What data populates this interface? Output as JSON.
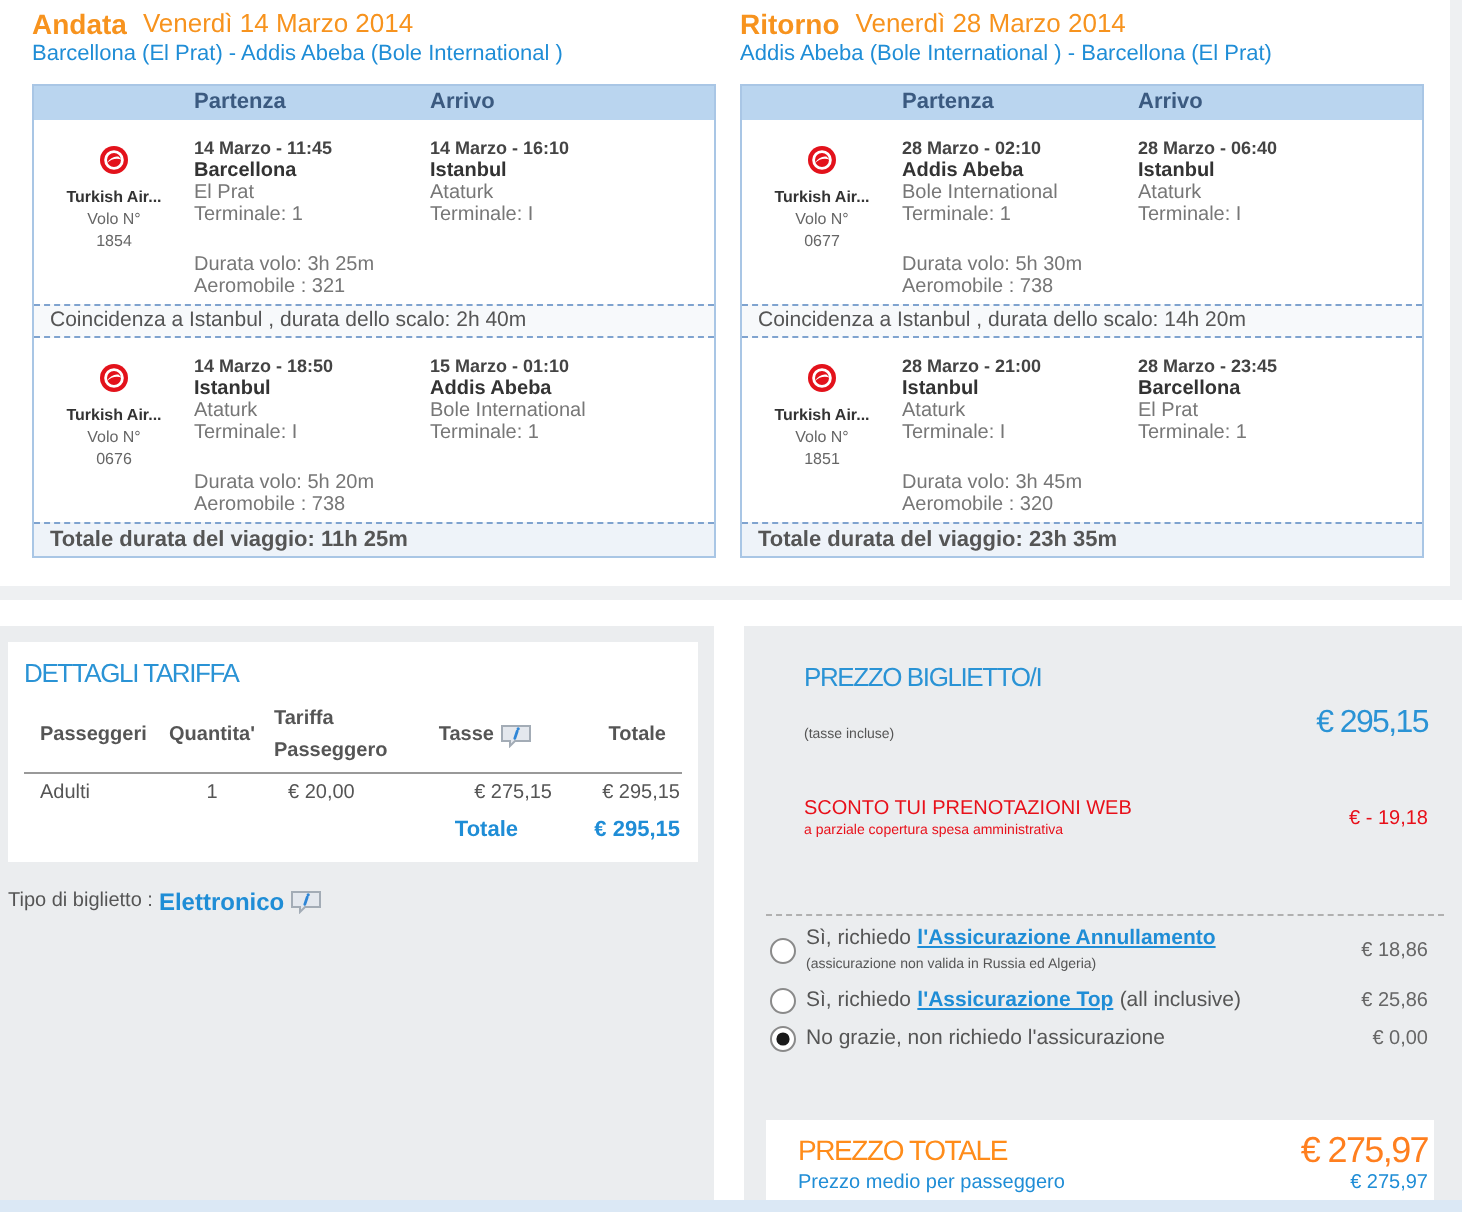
{
  "itineraries": [
    {
      "direction": "Andata",
      "date": "Venerdì 14 Marzo 2014",
      "route": "Barcellona (El Prat) - Addis Abeba (Bole International )",
      "columns": [
        "Partenza",
        "Arrivo"
      ],
      "items": [
        {
          "kind": "flight",
          "airline": "Turkish Air...",
          "flight_label": "Volo N°",
          "flight_number": "1854",
          "departure": {
            "datetime": "14 Marzo - 11:45",
            "city": "Barcellona",
            "airport": "El Prat",
            "terminal": "Terminale: 1"
          },
          "arrival": {
            "datetime": "14 Marzo - 16:10",
            "city": "Istanbul",
            "airport": "Ataturk",
            "terminal": "Terminale: I"
          },
          "duration": "Durata volo: 3h 25m",
          "aircraft": "Aeromobile : 321"
        },
        {
          "kind": "connection",
          "text": "Coincidenza a Istanbul , durata dello scalo: 2h 40m"
        },
        {
          "kind": "flight",
          "airline": "Turkish Air...",
          "flight_label": "Volo N°",
          "flight_number": "0676",
          "departure": {
            "datetime": "14 Marzo - 18:50",
            "city": "Istanbul",
            "airport": "Ataturk",
            "terminal": "Terminale: I"
          },
          "arrival": {
            "datetime": "15 Marzo - 01:10",
            "city": "Addis Abeba",
            "airport": "Bole International",
            "terminal": "Terminale: 1"
          },
          "duration": "Durata volo: 5h 20m",
          "aircraft": "Aeromobile : 738"
        }
      ],
      "total": "Totale durata del viaggio: 11h 25m"
    },
    {
      "direction": "Ritorno",
      "date": "Venerdì 28 Marzo 2014",
      "route": "Addis Abeba (Bole International ) - Barcellona (El Prat)",
      "columns": [
        "Partenza",
        "Arrivo"
      ],
      "items": [
        {
          "kind": "flight",
          "airline": "Turkish Air...",
          "flight_label": "Volo N°",
          "flight_number": "0677",
          "departure": {
            "datetime": "28 Marzo - 02:10",
            "city": "Addis Abeba",
            "airport": "Bole International",
            "terminal": "Terminale: 1"
          },
          "arrival": {
            "datetime": "28 Marzo - 06:40",
            "city": "Istanbul",
            "airport": "Ataturk",
            "terminal": "Terminale: I"
          },
          "duration": "Durata volo: 5h 30m",
          "aircraft": "Aeromobile : 738"
        },
        {
          "kind": "connection",
          "text": "Coincidenza a Istanbul , durata dello scalo: 14h 20m"
        },
        {
          "kind": "flight",
          "airline": "Turkish Air...",
          "flight_label": "Volo N°",
          "flight_number": "1851",
          "departure": {
            "datetime": "28 Marzo - 21:00",
            "city": "Istanbul",
            "airport": "Ataturk",
            "terminal": "Terminale: I"
          },
          "arrival": {
            "datetime": "28 Marzo - 23:45",
            "city": "Barcellona",
            "airport": "El Prat",
            "terminal": "Terminale: 1"
          },
          "duration": "Durata volo: 3h 45m",
          "aircraft": "Aeromobile : 320"
        }
      ],
      "total": "Totale durata del viaggio: 23h 35m"
    }
  ],
  "fare_details": {
    "title": "DETTAGLI TARIFFA",
    "columns": [
      {
        "label": "Passeggeri",
        "info": false
      },
      {
        "label": "Quantita'",
        "info": false
      },
      {
        "label": "Tariffa Passeggero",
        "info": false
      },
      {
        "label": "Tasse",
        "info": true
      },
      {
        "label": "Totale",
        "info": false
      }
    ],
    "rows": [
      [
        "Adulti",
        "1",
        "€ 20,00",
        "€ 275,15",
        "€ 295,15"
      ]
    ],
    "total_label": "Totale",
    "total_value": "€ 295,15"
  },
  "ticket_type": {
    "label": "Tipo di biglietto :",
    "value": "Elettronico",
    "info": true
  },
  "price_summary": {
    "title": "PREZZO BIGLIETTO/I",
    "note": "(tasse incluse)",
    "amount": "€ 295,15",
    "discount": {
      "title": "SCONTO TUI PRENOTAZIONI WEB",
      "subtitle": "a parziale copertura spesa amministrativa",
      "amount": "€ - 19,18"
    },
    "insurance_options": [
      {
        "prefix": "Sì, richiedo",
        "link": "l'Assicurazione Annullamento",
        "note": "(assicurazione non valida in Russia ed Algeria)",
        "price": "€ 18,86",
        "selected": false
      },
      {
        "prefix": "Sì, richiedo",
        "link": "l'Assicurazione Top",
        "suffix": "(all inclusive)",
        "price": "€ 25,86",
        "selected": false
      },
      {
        "prefix": "No grazie, non richiedo l'assicurazione",
        "price": "€ 0,00",
        "selected": true
      }
    ],
    "total": {
      "title": "PREZZO TOTALE",
      "amount": "€ 275,97",
      "average_label": "Prezzo medio per passeggero",
      "average_amount": "€ 275,97"
    }
  }
}
